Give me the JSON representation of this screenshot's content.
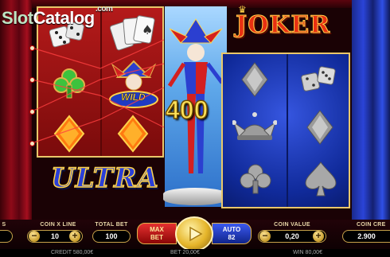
{
  "watermark": {
    "part1": "Slot",
    "part2": "Catalog",
    "suffix": ".com"
  },
  "logos": {
    "top_right": "JOKER",
    "bottom_left": "ULTRA"
  },
  "reels": {
    "left_grid": [
      [
        "dice",
        "cards-fan"
      ],
      [
        "club",
        "wild-joker"
      ],
      [
        "diamond",
        "diamond"
      ]
    ],
    "right_grid": [
      [
        "diamond",
        "dice"
      ],
      [
        "jester-hat",
        "diamond"
      ],
      [
        "club",
        "spade"
      ]
    ],
    "wild_label": "WILD"
  },
  "win": {
    "amount": "400"
  },
  "controls": {
    "lines": {
      "label": "S",
      "value": ""
    },
    "coin_x_line": {
      "label": "COIN X LINE",
      "value": "10",
      "minus": "−",
      "plus": "+"
    },
    "total_bet": {
      "label": "TOTAL BET",
      "value": "100"
    },
    "max_bet": {
      "line1": "MAX",
      "line2": "BET"
    },
    "auto": {
      "line1": "AUTO",
      "line2": "82"
    },
    "coin_value": {
      "label": "COIN VALUE",
      "value": "0,20",
      "minus": "−",
      "plus": "+"
    },
    "coin_credit": {
      "label": "COIN CRE",
      "value": "2.900"
    }
  },
  "status": {
    "credit": "CREDIT 580,00€",
    "bet": "BET 20,00€",
    "win": "WIN 80,00€"
  },
  "colors": {
    "gold": "#e9c76a",
    "red_reel": "#b41a1a",
    "blue_reel": "#1c3ac2"
  }
}
